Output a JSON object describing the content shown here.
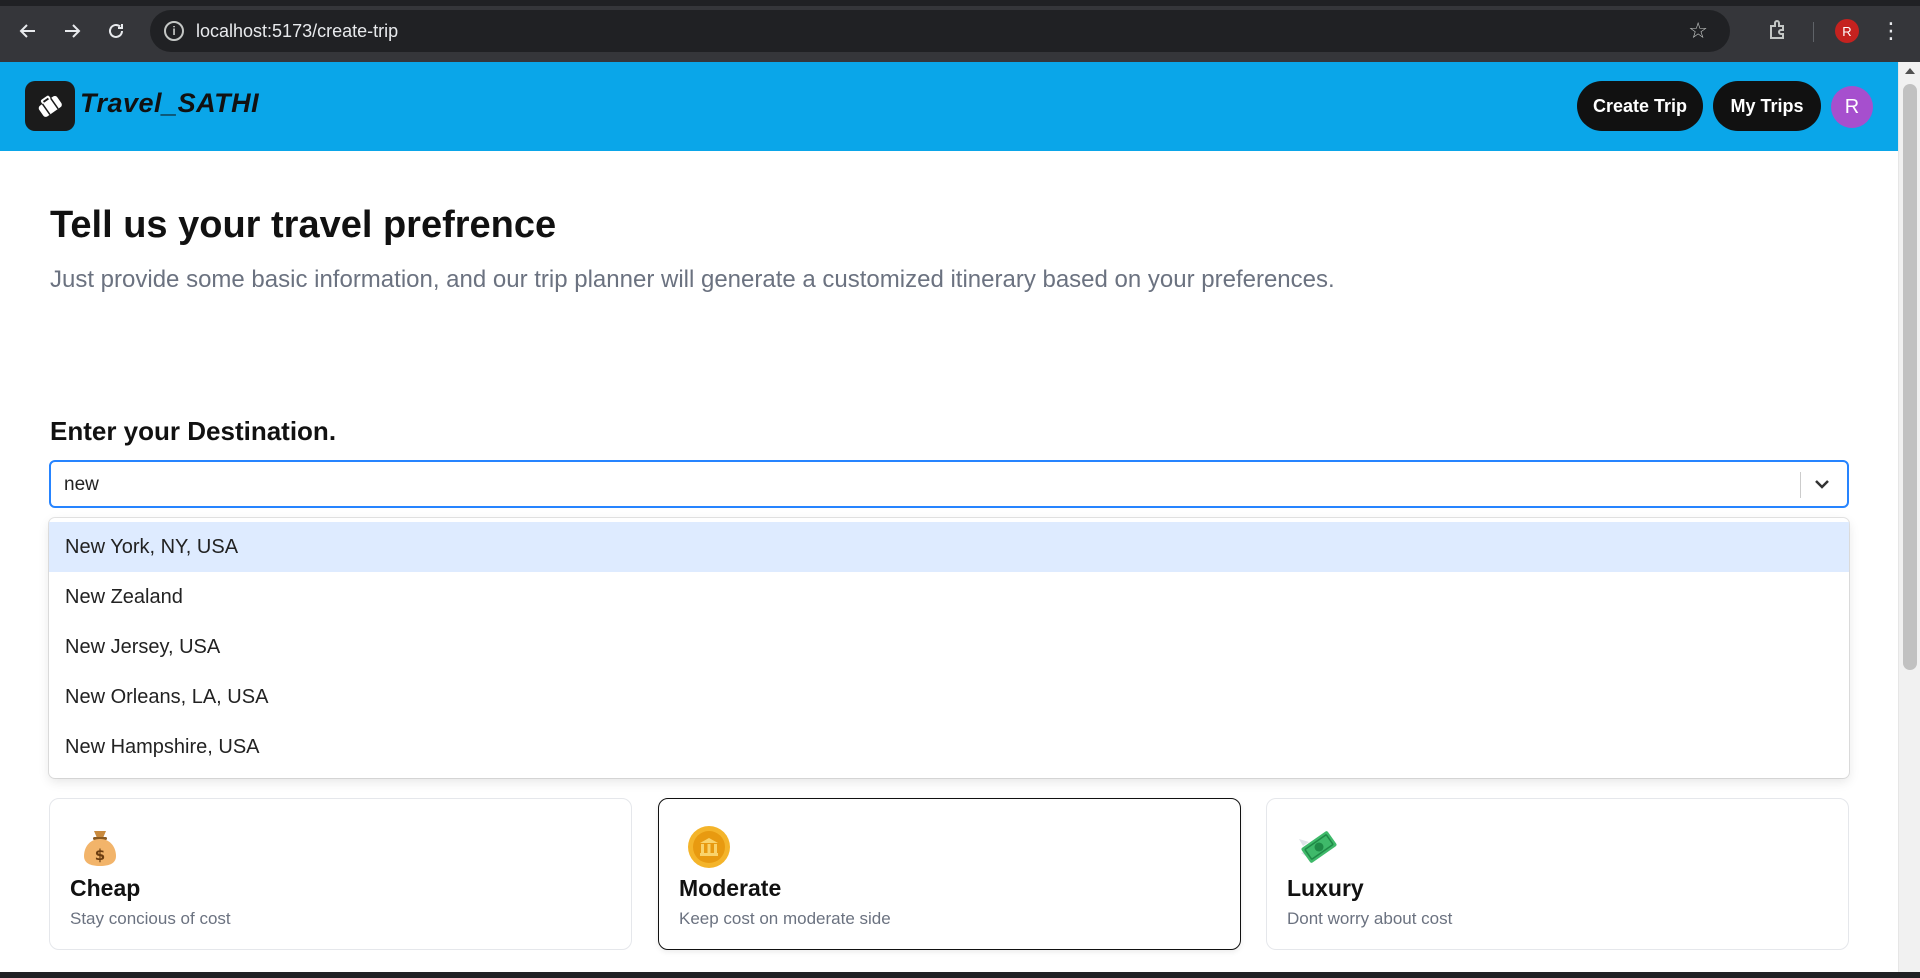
{
  "browser": {
    "url": "localhost:5173/create-trip",
    "profile_initial": "R"
  },
  "header": {
    "brand": "Travel_SATHI",
    "create_trip_label": "Create Trip",
    "my_trips_label": "My Trips",
    "avatar_initial": "R"
  },
  "main": {
    "title": "Tell us your travel prefrence",
    "subtitle": "Just provide some basic information, and our trip planner will generate a customized itinerary based on your preferences.",
    "destination_label": "Enter your Destination.",
    "destination_value": "new",
    "suggestions": [
      "New York, NY, USA",
      "New Zealand",
      "New Jersey, USA",
      "New Orleans, LA, USA",
      "New Hampshire, USA"
    ],
    "focused_suggestion_index": 0
  },
  "budget": [
    {
      "title": "Cheap",
      "desc": "Stay concious of cost",
      "icon": "money-bag-icon",
      "selected": false
    },
    {
      "title": "Moderate",
      "desc": "Keep cost on moderate side",
      "icon": "bank-coin-icon",
      "selected": true
    },
    {
      "title": "Luxury",
      "desc": "Dont worry about cost",
      "icon": "flying-money-icon",
      "selected": false
    }
  ],
  "colors": {
    "header_bg": "#0aa6e9",
    "focus_blue": "#2684ff",
    "option_focus": "#deebff",
    "avatar": "#a64fce"
  }
}
